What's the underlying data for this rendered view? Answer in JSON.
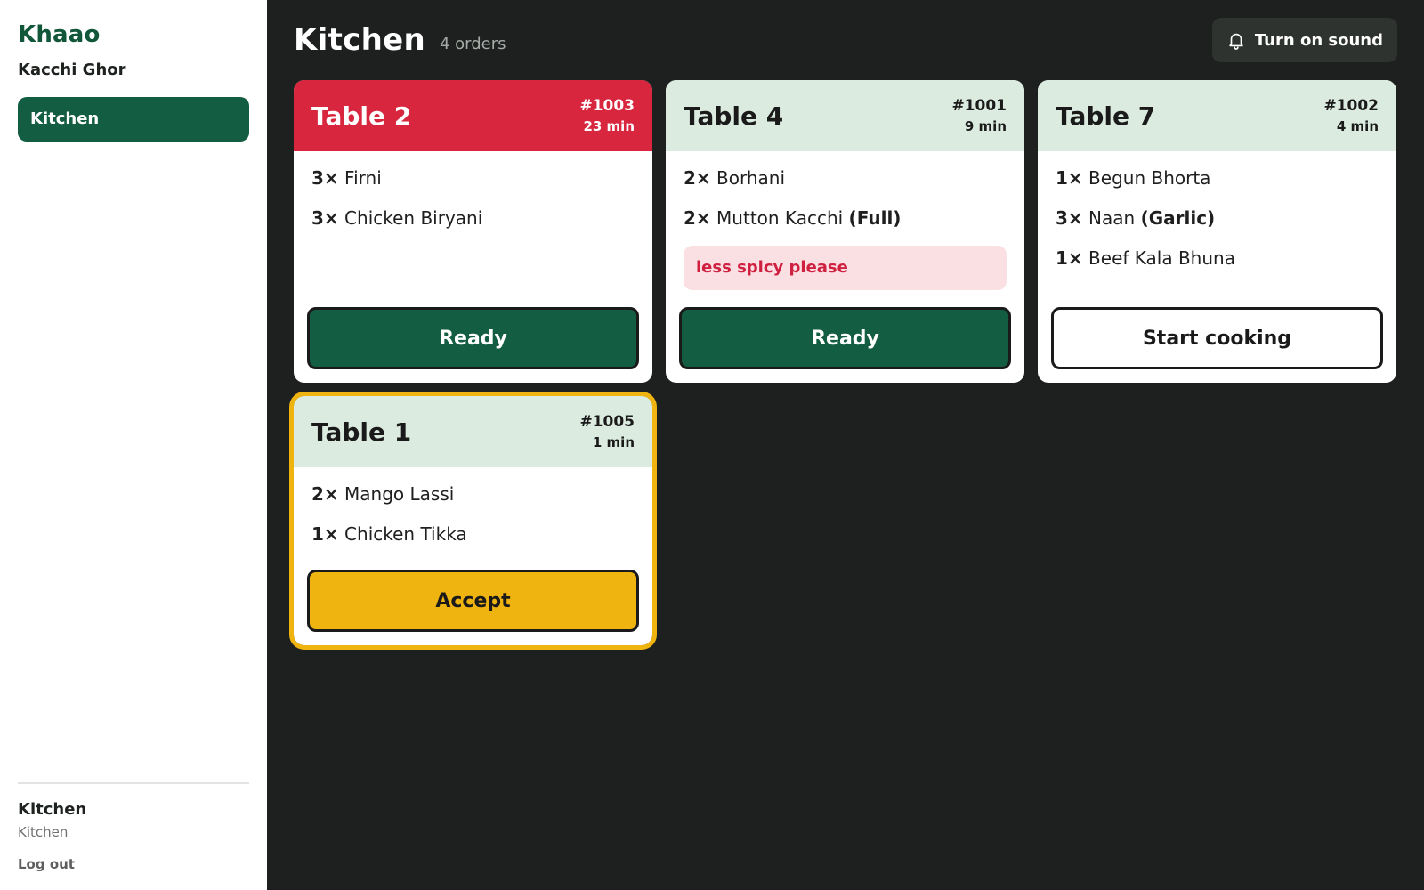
{
  "sidebar": {
    "brand": "Khaao",
    "restaurant": "Kacchi Ghor",
    "nav": [
      {
        "label": "Kitchen",
        "active": true
      }
    ],
    "user": {
      "name": "Kitchen",
      "role": "Kitchen"
    },
    "logout_label": "Log out"
  },
  "header": {
    "title": "Kitchen",
    "order_count": "4 orders",
    "sound_button": {
      "label": "Turn on sound",
      "icon": "bell-icon"
    }
  },
  "colors": {
    "urgent_header": "#d7263d",
    "normal_header": "#dbebdf",
    "ready_button": "#135d42",
    "accept_button": "#efb40f",
    "note_text": "#d02040"
  },
  "orders": [
    {
      "table": "Table 2",
      "order_id": "#1003",
      "elapsed": "23 min",
      "status": "urgent",
      "items": [
        {
          "qty": "3×",
          "name": "Firni",
          "modifier": ""
        },
        {
          "qty": "3×",
          "name": "Chicken Biryani",
          "modifier": ""
        }
      ],
      "note": "",
      "action": "Ready"
    },
    {
      "table": "Table 4",
      "order_id": "#1001",
      "elapsed": "9 min",
      "status": "normal",
      "items": [
        {
          "qty": "2×",
          "name": "Borhani",
          "modifier": ""
        },
        {
          "qty": "2×",
          "name": "Mutton Kacchi",
          "modifier": "(Full)"
        }
      ],
      "note": "less spicy please",
      "action": "Ready"
    },
    {
      "table": "Table 7",
      "order_id": "#1002",
      "elapsed": "4 min",
      "status": "normal",
      "items": [
        {
          "qty": "1×",
          "name": "Begun Bhorta",
          "modifier": ""
        },
        {
          "qty": "3×",
          "name": "Naan",
          "modifier": "(Garlic)"
        },
        {
          "qty": "1×",
          "name": "Beef Kala Bhuna",
          "modifier": ""
        }
      ],
      "note": "",
      "action": "Start cooking"
    },
    {
      "table": "Table 1",
      "order_id": "#1005",
      "elapsed": "1 min",
      "status": "new",
      "items": [
        {
          "qty": "2×",
          "name": "Mango Lassi",
          "modifier": ""
        },
        {
          "qty": "1×",
          "name": "Chicken Tikka",
          "modifier": ""
        }
      ],
      "note": "",
      "action": "Accept"
    }
  ]
}
